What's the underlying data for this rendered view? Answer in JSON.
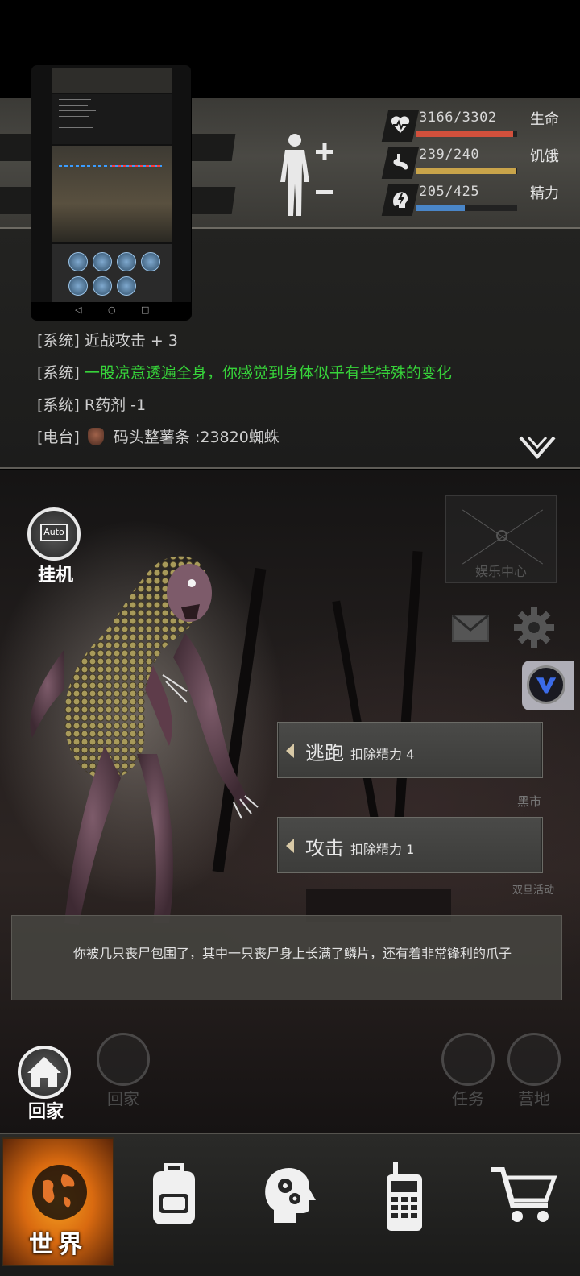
{
  "status": {
    "hp": {
      "label": "生命",
      "value": "3166/3302",
      "fraction": 0.959,
      "color": "#d2503c"
    },
    "hunger": {
      "label": "饥饿",
      "value": "239/240",
      "fraction": 0.996,
      "color": "#c9a44a"
    },
    "stamina": {
      "label": "精力",
      "value": "205/425",
      "fraction": 0.482,
      "color": "#4a86c8"
    },
    "body_icons": {
      "plus": "+",
      "minus": "−"
    }
  },
  "log": {
    "lines": [
      {
        "tag": "[系统]",
        "text": "近战攻击 + 3"
      },
      {
        "tag": "[系统]",
        "text": "一股凉意透遍全身，你感觉到身体似乎有些特殊的变化"
      },
      {
        "tag": "[系统]",
        "text": "R药剂 -1"
      },
      {
        "tag": "[电台]",
        "text": "码头整薯条 :23820蜘蛛"
      }
    ],
    "collapse_icon": "chevron-down-icon"
  },
  "scene": {
    "auto": {
      "badge": "Auto",
      "label": "挂机"
    },
    "entertainment_center": "娱乐中心",
    "side_labels": {
      "black_market": "黑市",
      "double_event": "双旦活动"
    },
    "actions": [
      {
        "label": "逃跑",
        "cost": "扣除精力 4"
      },
      {
        "label": "攻击",
        "cost": "扣除精力 1"
      }
    ],
    "story": "你被几只丧尸包围了，其中一只丧尸身上长满了鳞片，还有着非常锋利的爪子",
    "home_label": "回家",
    "ghost_buttons": {
      "home": "回家",
      "task": "任务",
      "camp": "营地"
    }
  },
  "nav": [
    {
      "label": "世界",
      "icon": "globe-icon",
      "active": true
    },
    {
      "label": "",
      "icon": "backpack-icon",
      "active": false
    },
    {
      "label": "",
      "icon": "head-gears-icon",
      "active": false
    },
    {
      "label": "",
      "icon": "radio-icon",
      "active": false
    },
    {
      "label": "",
      "icon": "cart-icon",
      "active": false
    }
  ],
  "mini_nav": {
    "back": "◁",
    "home": "○",
    "recent": "□"
  }
}
